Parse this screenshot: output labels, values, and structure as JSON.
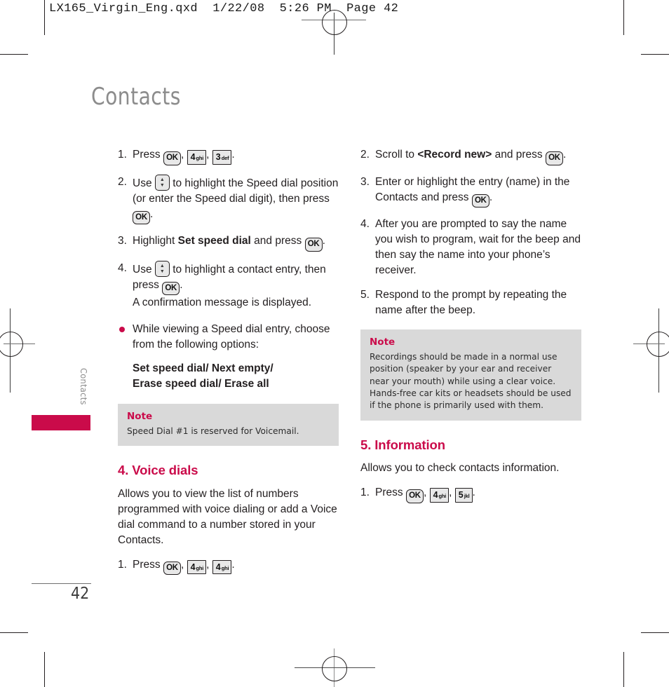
{
  "print_marks": {
    "slug": "LX165_Virgin_Eng.qxd  1/22/08  5:26 PM  Page 42"
  },
  "page": {
    "title": "Contacts",
    "side_tab_label": "Contacts",
    "page_number": "42",
    "accent_color": "#ca0b4a",
    "title_color": "#8c8c8c",
    "note_background": "#d9d9d9"
  },
  "keys": {
    "ok": "OK",
    "k3_digit": "3",
    "k3_sub": "def",
    "k4_digit": "4",
    "k4_sub": "ghi",
    "k5_digit": "5",
    "k5_sub": "jkl",
    "nav_up": "▲",
    "nav_down": "▼"
  },
  "left_column": {
    "steps": [
      {
        "num": "1.",
        "pre": "Press",
        "post": "."
      },
      {
        "num": "2.",
        "pre": "Use",
        "post": "to highlight the Speed dial position (or enter the Speed dial digit), then press",
        "tail": "."
      },
      {
        "num": "3.",
        "pre": "Highlight",
        "bold": "Set speed dial",
        "post": "and press",
        "tail": "."
      },
      {
        "num": "4.",
        "pre": "Use",
        "post": "to highlight a contact entry, then press",
        "tail": ".",
        "extra": "A confirmation message is displayed."
      }
    ],
    "bullet": "While viewing a Speed dial entry, choose from the following options:",
    "options_line1": "Set speed dial/ Next empty/",
    "options_line2": "Erase speed dial/ Erase all",
    "note": {
      "title": "Note",
      "body": "Speed Dial #1 is reserved for Voicemail."
    },
    "section": {
      "heading": "4. Voice dials",
      "paragraph": "Allows you to view the list of numbers programmed with voice dialing or add a Voice dial command to a number stored in your Contacts.",
      "step_num": "1.",
      "step_pre": "Press",
      "step_tail": "."
    }
  },
  "right_column": {
    "steps": [
      {
        "num": "2.",
        "pre": "Scroll to",
        "bold": "<Record new>",
        "post": "and press",
        "tail": "."
      },
      {
        "num": "3.",
        "pre": "Enter or highlight the entry (name) in the Contacts and press",
        "tail": "."
      },
      {
        "num": "4.",
        "pre": "After you are prompted to say the name you wish to program, wait for the beep and then say the name into your phone’s receiver."
      },
      {
        "num": "5.",
        "pre": "Respond to the prompt by repeating the name after the beep."
      }
    ],
    "note": {
      "title": "Note",
      "body": "Recordings should be made in a normal use position (speaker by your ear and receiver near your mouth) while using a clear voice. Hands-free car kits or headsets should be used if the phone is primarily used with them."
    },
    "section": {
      "heading": "5. Information",
      "paragraph": "Allows you to check contacts information.",
      "step_num": "1.",
      "step_pre": "Press",
      "step_tail": "."
    }
  }
}
